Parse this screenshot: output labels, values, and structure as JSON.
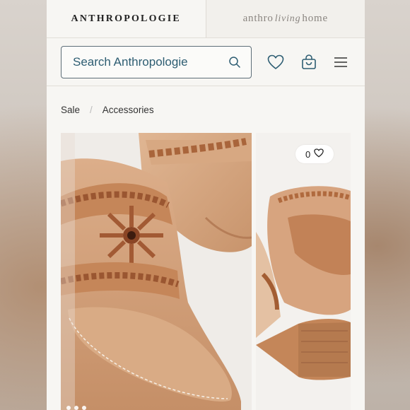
{
  "brand_tabs": {
    "active": "ANTHROPOLOGIE",
    "inactive_prefix": "anthro",
    "inactive_script": "living",
    "inactive_suffix": "home"
  },
  "search": {
    "placeholder": "Search Anthropologie",
    "value": ""
  },
  "header_icons": [
    "heart-icon",
    "shopping-bag-icon",
    "hamburger-menu-icon"
  ],
  "breadcrumb": {
    "items": [
      "Sale",
      "Accessories"
    ],
    "separator": "/"
  },
  "gallery": {
    "favorite_count": "0",
    "favorite_icon": "heart-icon"
  },
  "colors": {
    "accent": "#2d5d72",
    "brand_text": "#222222",
    "leather": "#d4a27f"
  }
}
